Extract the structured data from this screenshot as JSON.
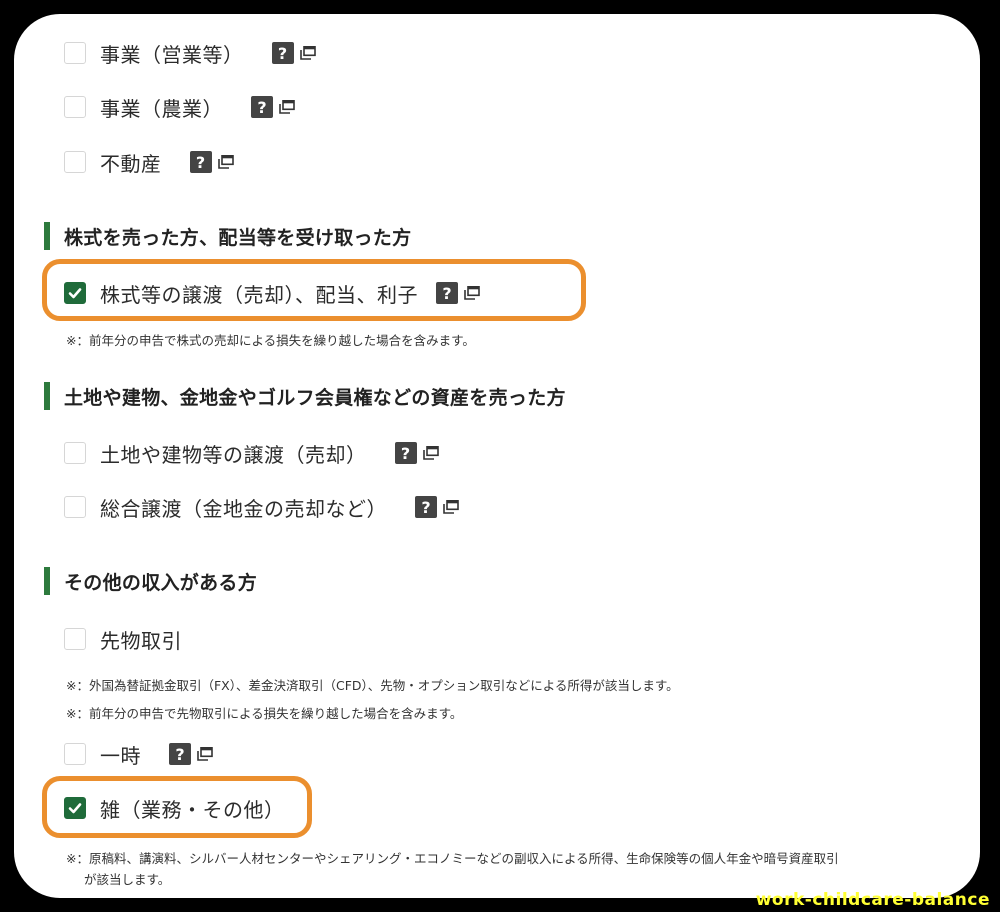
{
  "items": {
    "business_sales": {
      "label": "事業（営業等）",
      "checked": false
    },
    "business_agri": {
      "label": "事業（農業）",
      "checked": false
    },
    "real_estate": {
      "label": "不動産",
      "checked": false
    },
    "stock_transfer": {
      "label": "株式等の譲渡（売却）、配当、利子",
      "checked": true
    },
    "land_transfer": {
      "label": "土地や建物等の譲渡（売却）",
      "checked": false
    },
    "general_transfer": {
      "label": "総合譲渡（金地金の売却など）",
      "checked": false
    },
    "futures": {
      "label": "先物取引",
      "checked": false
    },
    "temporary": {
      "label": "一時",
      "checked": false
    },
    "misc": {
      "label": "雑（業務・その他）",
      "checked": true
    }
  },
  "sections": {
    "stocks": "株式を売った方、配当等を受け取った方",
    "assets": "土地や建物、金地金やゴルフ会員権などの資産を売った方",
    "other_income": "その他の収入がある方"
  },
  "notes": {
    "stock_loss": "※：前年分の申告で株式の売却による損失を繰り越した場合を含みます。",
    "futures_fx": "※：外国為替証拠金取引（FX）、差金決済取引（CFD）、先物・オプション取引などによる所得が該当します。",
    "futures_loss": "※：前年分の申告で先物取引による損失を繰り越した場合を含みます。",
    "misc_line1": "※：原稿料、講演料、シルバー人材センターやシェアリング・エコノミーなどの副収入による所得、生命保険等の個人年金や暗号資産取引",
    "misc_line2": "が該当します。"
  },
  "help_glyph": "?",
  "icons": {
    "help": "question-icon",
    "popup": "new-window-icon",
    "check": "checkmark-icon"
  },
  "colors": {
    "accent": "#1f6b3a",
    "highlight": "#eb8f2e",
    "section_bar": "#2d7a3d"
  },
  "watermark": "work-childcare-balance"
}
